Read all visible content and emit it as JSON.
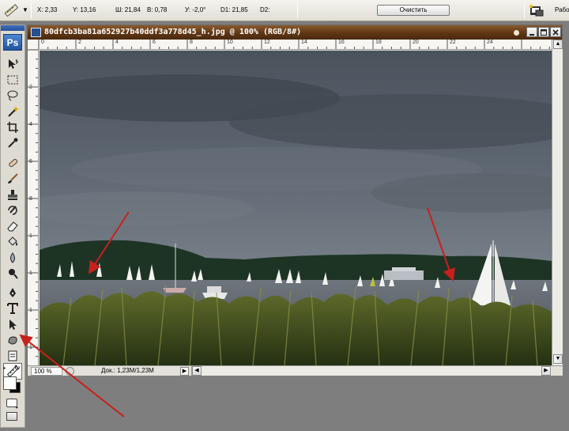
{
  "options_bar": {
    "x": "X: 2,33",
    "y": "Y: 13,16",
    "w": "Ш: 21,84",
    "h": "В: 0,78",
    "angle": "У: -2,0°",
    "d1": "D1: 21,85",
    "d2": "D2:",
    "clear_label": "Очистить",
    "workspace_label": "Рабо"
  },
  "toolbox": {
    "logo": "Ps",
    "active_tool": "ruler-tool"
  },
  "document": {
    "title": "80dfcb3ba81a652927b40ddf3a778d45_h.jpg @ 100% (RGB/8#)",
    "zoom": "100 %",
    "doc_size": "Док.: 1,23M/1,23M",
    "ruler_h_labels": [
      "0",
      "2",
      "4",
      "6",
      "8",
      "10",
      "12",
      "14",
      "16",
      "18",
      "20",
      "22",
      "24"
    ],
    "ruler_v_labels": [
      "2",
      "4",
      "6",
      "8",
      "1",
      "1",
      "1",
      "1"
    ]
  },
  "colors": {
    "title_bar": "#5e3514",
    "annotation_arrow": "#c8201c",
    "selected_tool_bg": "#ffffff"
  }
}
